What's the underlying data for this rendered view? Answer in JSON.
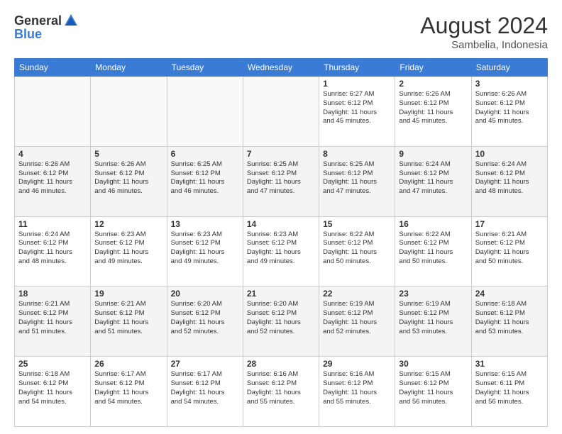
{
  "header": {
    "logo_general": "General",
    "logo_blue": "Blue",
    "month_year": "August 2024",
    "location": "Sambelia, Indonesia"
  },
  "days_of_week": [
    "Sunday",
    "Monday",
    "Tuesday",
    "Wednesday",
    "Thursday",
    "Friday",
    "Saturday"
  ],
  "weeks": [
    {
      "even": false,
      "days": [
        {
          "num": "",
          "info": ""
        },
        {
          "num": "",
          "info": ""
        },
        {
          "num": "",
          "info": ""
        },
        {
          "num": "",
          "info": ""
        },
        {
          "num": "1",
          "info": "Sunrise: 6:27 AM\nSunset: 6:12 PM\nDaylight: 11 hours\nand 45 minutes."
        },
        {
          "num": "2",
          "info": "Sunrise: 6:26 AM\nSunset: 6:12 PM\nDaylight: 11 hours\nand 45 minutes."
        },
        {
          "num": "3",
          "info": "Sunrise: 6:26 AM\nSunset: 6:12 PM\nDaylight: 11 hours\nand 45 minutes."
        }
      ]
    },
    {
      "even": true,
      "days": [
        {
          "num": "4",
          "info": "Sunrise: 6:26 AM\nSunset: 6:12 PM\nDaylight: 11 hours\nand 46 minutes."
        },
        {
          "num": "5",
          "info": "Sunrise: 6:26 AM\nSunset: 6:12 PM\nDaylight: 11 hours\nand 46 minutes."
        },
        {
          "num": "6",
          "info": "Sunrise: 6:25 AM\nSunset: 6:12 PM\nDaylight: 11 hours\nand 46 minutes."
        },
        {
          "num": "7",
          "info": "Sunrise: 6:25 AM\nSunset: 6:12 PM\nDaylight: 11 hours\nand 47 minutes."
        },
        {
          "num": "8",
          "info": "Sunrise: 6:25 AM\nSunset: 6:12 PM\nDaylight: 11 hours\nand 47 minutes."
        },
        {
          "num": "9",
          "info": "Sunrise: 6:24 AM\nSunset: 6:12 PM\nDaylight: 11 hours\nand 47 minutes."
        },
        {
          "num": "10",
          "info": "Sunrise: 6:24 AM\nSunset: 6:12 PM\nDaylight: 11 hours\nand 48 minutes."
        }
      ]
    },
    {
      "even": false,
      "days": [
        {
          "num": "11",
          "info": "Sunrise: 6:24 AM\nSunset: 6:12 PM\nDaylight: 11 hours\nand 48 minutes."
        },
        {
          "num": "12",
          "info": "Sunrise: 6:23 AM\nSunset: 6:12 PM\nDaylight: 11 hours\nand 49 minutes."
        },
        {
          "num": "13",
          "info": "Sunrise: 6:23 AM\nSunset: 6:12 PM\nDaylight: 11 hours\nand 49 minutes."
        },
        {
          "num": "14",
          "info": "Sunrise: 6:23 AM\nSunset: 6:12 PM\nDaylight: 11 hours\nand 49 minutes."
        },
        {
          "num": "15",
          "info": "Sunrise: 6:22 AM\nSunset: 6:12 PM\nDaylight: 11 hours\nand 50 minutes."
        },
        {
          "num": "16",
          "info": "Sunrise: 6:22 AM\nSunset: 6:12 PM\nDaylight: 11 hours\nand 50 minutes."
        },
        {
          "num": "17",
          "info": "Sunrise: 6:21 AM\nSunset: 6:12 PM\nDaylight: 11 hours\nand 50 minutes."
        }
      ]
    },
    {
      "even": true,
      "days": [
        {
          "num": "18",
          "info": "Sunrise: 6:21 AM\nSunset: 6:12 PM\nDaylight: 11 hours\nand 51 minutes."
        },
        {
          "num": "19",
          "info": "Sunrise: 6:21 AM\nSunset: 6:12 PM\nDaylight: 11 hours\nand 51 minutes."
        },
        {
          "num": "20",
          "info": "Sunrise: 6:20 AM\nSunset: 6:12 PM\nDaylight: 11 hours\nand 52 minutes."
        },
        {
          "num": "21",
          "info": "Sunrise: 6:20 AM\nSunset: 6:12 PM\nDaylight: 11 hours\nand 52 minutes."
        },
        {
          "num": "22",
          "info": "Sunrise: 6:19 AM\nSunset: 6:12 PM\nDaylight: 11 hours\nand 52 minutes."
        },
        {
          "num": "23",
          "info": "Sunrise: 6:19 AM\nSunset: 6:12 PM\nDaylight: 11 hours\nand 53 minutes."
        },
        {
          "num": "24",
          "info": "Sunrise: 6:18 AM\nSunset: 6:12 PM\nDaylight: 11 hours\nand 53 minutes."
        }
      ]
    },
    {
      "even": false,
      "days": [
        {
          "num": "25",
          "info": "Sunrise: 6:18 AM\nSunset: 6:12 PM\nDaylight: 11 hours\nand 54 minutes."
        },
        {
          "num": "26",
          "info": "Sunrise: 6:17 AM\nSunset: 6:12 PM\nDaylight: 11 hours\nand 54 minutes."
        },
        {
          "num": "27",
          "info": "Sunrise: 6:17 AM\nSunset: 6:12 PM\nDaylight: 11 hours\nand 54 minutes."
        },
        {
          "num": "28",
          "info": "Sunrise: 6:16 AM\nSunset: 6:12 PM\nDaylight: 11 hours\nand 55 minutes."
        },
        {
          "num": "29",
          "info": "Sunrise: 6:16 AM\nSunset: 6:12 PM\nDaylight: 11 hours\nand 55 minutes."
        },
        {
          "num": "30",
          "info": "Sunrise: 6:15 AM\nSunset: 6:12 PM\nDaylight: 11 hours\nand 56 minutes."
        },
        {
          "num": "31",
          "info": "Sunrise: 6:15 AM\nSunset: 6:11 PM\nDaylight: 11 hours\nand 56 minutes."
        }
      ]
    }
  ]
}
